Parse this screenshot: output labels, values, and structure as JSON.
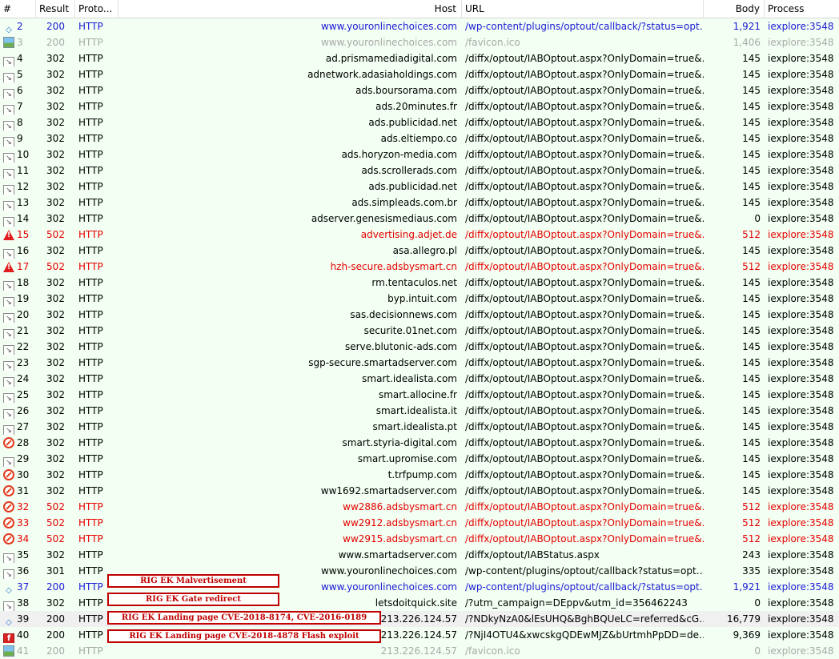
{
  "columns": {
    "num": "#",
    "result": "Result",
    "protocol": "Proto...",
    "host": "Host",
    "url": "URL",
    "body": "Body",
    "process": "Process"
  },
  "colors": {
    "blue": "#1b1bd6",
    "gray": "#a9a9a9",
    "black": "#000000",
    "red": "#e60000",
    "bg_green": "#f2fff2",
    "bg_selected": "#f0f0f0",
    "annotation_red": "#c00000"
  },
  "rows": [
    {
      "num": "2",
      "result": "200",
      "protocol": "HTTP",
      "host": "www.youronlinechoices.com",
      "url": "/wp-content/plugins/optout/callback/?status=opt…",
      "body": "1,921",
      "process": "iexplore:3548",
      "icon": "arrows-icon",
      "color": "blue",
      "bg": "bg_green"
    },
    {
      "num": "3",
      "result": "200",
      "protocol": "HTTP",
      "host": "www.youronlinechoices.com",
      "url": "/favicon.ico",
      "body": "1,406",
      "process": "iexplore:3548",
      "icon": "image-icon",
      "color": "gray",
      "bg": "bg_green"
    },
    {
      "num": "4",
      "result": "302",
      "protocol": "HTTP",
      "host": "ad.prismamediadigital.com",
      "url": "/diffx/optout/IABOptout.aspx?OnlyDomain=true&…",
      "body": "145",
      "process": "iexplore:3548",
      "icon": "redirect-icon",
      "color": "black",
      "bg": "bg_green"
    },
    {
      "num": "5",
      "result": "302",
      "protocol": "HTTP",
      "host": "adnetwork.adasiaholdings.com",
      "url": "/diffx/optout/IABOptout.aspx?OnlyDomain=true&…",
      "body": "145",
      "process": "iexplore:3548",
      "icon": "redirect-icon",
      "color": "black",
      "bg": "bg_green"
    },
    {
      "num": "6",
      "result": "302",
      "protocol": "HTTP",
      "host": "ads.boursorama.com",
      "url": "/diffx/optout/IABOptout.aspx?OnlyDomain=true&…",
      "body": "145",
      "process": "iexplore:3548",
      "icon": "redirect-icon",
      "color": "black",
      "bg": "bg_green"
    },
    {
      "num": "7",
      "result": "302",
      "protocol": "HTTP",
      "host": "ads.20minutes.fr",
      "url": "/diffx/optout/IABOptout.aspx?OnlyDomain=true&…",
      "body": "145",
      "process": "iexplore:3548",
      "icon": "redirect-icon",
      "color": "black",
      "bg": "bg_green"
    },
    {
      "num": "8",
      "result": "302",
      "protocol": "HTTP",
      "host": "ads.publicidad.net",
      "url": "/diffx/optout/IABOptout.aspx?OnlyDomain=true&…",
      "body": "145",
      "process": "iexplore:3548",
      "icon": "redirect-icon",
      "color": "black",
      "bg": "bg_green"
    },
    {
      "num": "9",
      "result": "302",
      "protocol": "HTTP",
      "host": "ads.eltiempo.co",
      "url": "/diffx/optout/IABOptout.aspx?OnlyDomain=true&…",
      "body": "145",
      "process": "iexplore:3548",
      "icon": "redirect-icon",
      "color": "black",
      "bg": "bg_green"
    },
    {
      "num": "10",
      "result": "302",
      "protocol": "HTTP",
      "host": "ads.horyzon-media.com",
      "url": "/diffx/optout/IABOptout.aspx?OnlyDomain=true&…",
      "body": "145",
      "process": "iexplore:3548",
      "icon": "redirect-icon",
      "color": "black",
      "bg": "bg_green"
    },
    {
      "num": "11",
      "result": "302",
      "protocol": "HTTP",
      "host": "ads.scrollerads.com",
      "url": "/diffx/optout/IABOptout.aspx?OnlyDomain=true&…",
      "body": "145",
      "process": "iexplore:3548",
      "icon": "redirect-icon",
      "color": "black",
      "bg": "bg_green"
    },
    {
      "num": "12",
      "result": "302",
      "protocol": "HTTP",
      "host": "ads.publicidad.net",
      "url": "/diffx/optout/IABOptout.aspx?OnlyDomain=true&…",
      "body": "145",
      "process": "iexplore:3548",
      "icon": "redirect-icon",
      "color": "black",
      "bg": "bg_green"
    },
    {
      "num": "13",
      "result": "302",
      "protocol": "HTTP",
      "host": "ads.simpleads.com.br",
      "url": "/diffx/optout/IABOptout.aspx?OnlyDomain=true&…",
      "body": "145",
      "process": "iexplore:3548",
      "icon": "redirect-icon",
      "color": "black",
      "bg": "bg_green"
    },
    {
      "num": "14",
      "result": "302",
      "protocol": "HTTP",
      "host": "adserver.genesismediaus.com",
      "url": "/diffx/optout/IABOptout.aspx?OnlyDomain=true&…",
      "body": "0",
      "process": "iexplore:3548",
      "icon": "redirect-icon",
      "color": "black",
      "bg": "bg_green"
    },
    {
      "num": "15",
      "result": "502",
      "protocol": "HTTP",
      "host": "advertising.adjet.de",
      "url": "/diffx/optout/IABOptout.aspx?OnlyDomain=true&…",
      "body": "512",
      "process": "iexplore:3548",
      "icon": "warning-icon",
      "color": "red",
      "bg": "bg_green"
    },
    {
      "num": "16",
      "result": "302",
      "protocol": "HTTP",
      "host": "asa.allegro.pl",
      "url": "/diffx/optout/IABOptout.aspx?OnlyDomain=true&…",
      "body": "145",
      "process": "iexplore:3548",
      "icon": "redirect-icon",
      "color": "black",
      "bg": "bg_green"
    },
    {
      "num": "17",
      "result": "502",
      "protocol": "HTTP",
      "host": "hzh-secure.adsbysmart.cn",
      "url": "/diffx/optout/IABOptout.aspx?OnlyDomain=true&…",
      "body": "512",
      "process": "iexplore:3548",
      "icon": "warning-icon",
      "color": "red",
      "bg": "bg_green"
    },
    {
      "num": "18",
      "result": "302",
      "protocol": "HTTP",
      "host": "rm.tentaculos.net",
      "url": "/diffx/optout/IABOptout.aspx?OnlyDomain=true&…",
      "body": "145",
      "process": "iexplore:3548",
      "icon": "redirect-icon",
      "color": "black",
      "bg": "bg_green"
    },
    {
      "num": "19",
      "result": "302",
      "protocol": "HTTP",
      "host": "byp.intuit.com",
      "url": "/diffx/optout/IABOptout.aspx?OnlyDomain=true&…",
      "body": "145",
      "process": "iexplore:3548",
      "icon": "redirect-icon",
      "color": "black",
      "bg": "bg_green"
    },
    {
      "num": "20",
      "result": "302",
      "protocol": "HTTP",
      "host": "sas.decisionnews.com",
      "url": "/diffx/optout/IABOptout.aspx?OnlyDomain=true&…",
      "body": "145",
      "process": "iexplore:3548",
      "icon": "redirect-icon",
      "color": "black",
      "bg": "bg_green"
    },
    {
      "num": "21",
      "result": "302",
      "protocol": "HTTP",
      "host": "securite.01net.com",
      "url": "/diffx/optout/IABOptout.aspx?OnlyDomain=true&…",
      "body": "145",
      "process": "iexplore:3548",
      "icon": "redirect-icon",
      "color": "black",
      "bg": "bg_green"
    },
    {
      "num": "22",
      "result": "302",
      "protocol": "HTTP",
      "host": "serve.blutonic-ads.com",
      "url": "/diffx/optout/IABOptout.aspx?OnlyDomain=true&…",
      "body": "145",
      "process": "iexplore:3548",
      "icon": "redirect-icon",
      "color": "black",
      "bg": "bg_green"
    },
    {
      "num": "23",
      "result": "302",
      "protocol": "HTTP",
      "host": "sgp-secure.smartadserver.com",
      "url": "/diffx/optout/IABOptout.aspx?OnlyDomain=true&…",
      "body": "145",
      "process": "iexplore:3548",
      "icon": "redirect-icon",
      "color": "black",
      "bg": "bg_green"
    },
    {
      "num": "24",
      "result": "302",
      "protocol": "HTTP",
      "host": "smart.idealista.com",
      "url": "/diffx/optout/IABOptout.aspx?OnlyDomain=true&…",
      "body": "145",
      "process": "iexplore:3548",
      "icon": "redirect-icon",
      "color": "black",
      "bg": "bg_green"
    },
    {
      "num": "25",
      "result": "302",
      "protocol": "HTTP",
      "host": "smart.allocine.fr",
      "url": "/diffx/optout/IABOptout.aspx?OnlyDomain=true&…",
      "body": "145",
      "process": "iexplore:3548",
      "icon": "redirect-icon",
      "color": "black",
      "bg": "bg_green"
    },
    {
      "num": "26",
      "result": "302",
      "protocol": "HTTP",
      "host": "smart.idealista.it",
      "url": "/diffx/optout/IABOptout.aspx?OnlyDomain=true&…",
      "body": "145",
      "process": "iexplore:3548",
      "icon": "redirect-icon",
      "color": "black",
      "bg": "bg_green"
    },
    {
      "num": "27",
      "result": "302",
      "protocol": "HTTP",
      "host": "smart.idealista.pt",
      "url": "/diffx/optout/IABOptout.aspx?OnlyDomain=true&…",
      "body": "145",
      "process": "iexplore:3548",
      "icon": "redirect-icon",
      "color": "black",
      "bg": "bg_green"
    },
    {
      "num": "28",
      "result": "302",
      "protocol": "HTTP",
      "host": "smart.styria-digital.com",
      "url": "/diffx/optout/IABOptout.aspx?OnlyDomain=true&…",
      "body": "145",
      "process": "iexplore:3548",
      "icon": "blocked-icon",
      "color": "black",
      "bg": "bg_green"
    },
    {
      "num": "29",
      "result": "302",
      "protocol": "HTTP",
      "host": "smart.upromise.com",
      "url": "/diffx/optout/IABOptout.aspx?OnlyDomain=true&…",
      "body": "145",
      "process": "iexplore:3548",
      "icon": "redirect-icon",
      "color": "black",
      "bg": "bg_green"
    },
    {
      "num": "30",
      "result": "302",
      "protocol": "HTTP",
      "host": "t.trfpump.com",
      "url": "/diffx/optout/IABOptout.aspx?OnlyDomain=true&…",
      "body": "145",
      "process": "iexplore:3548",
      "icon": "blocked-icon",
      "color": "black",
      "bg": "bg_green"
    },
    {
      "num": "31",
      "result": "302",
      "protocol": "HTTP",
      "host": "ww1692.smartadserver.com",
      "url": "/diffx/optout/IABOptout.aspx?OnlyDomain=true&…",
      "body": "145",
      "process": "iexplore:3548",
      "icon": "blocked-icon",
      "color": "black",
      "bg": "bg_green"
    },
    {
      "num": "32",
      "result": "502",
      "protocol": "HTTP",
      "host": "ww2886.adsbysmart.cn",
      "url": "/diffx/optout/IABOptout.aspx?OnlyDomain=true&…",
      "body": "512",
      "process": "iexplore:3548",
      "icon": "blocked-icon",
      "color": "red",
      "bg": "bg_green"
    },
    {
      "num": "33",
      "result": "502",
      "protocol": "HTTP",
      "host": "ww2912.adsbysmart.cn",
      "url": "/diffx/optout/IABOptout.aspx?OnlyDomain=true&…",
      "body": "512",
      "process": "iexplore:3548",
      "icon": "blocked-icon",
      "color": "red",
      "bg": "bg_green"
    },
    {
      "num": "34",
      "result": "502",
      "protocol": "HTTP",
      "host": "ww2915.adsbysmart.cn",
      "url": "/diffx/optout/IABOptout.aspx?OnlyDomain=true&…",
      "body": "512",
      "process": "iexplore:3548",
      "icon": "blocked-icon",
      "color": "red",
      "bg": "bg_green"
    },
    {
      "num": "35",
      "result": "302",
      "protocol": "HTTP",
      "host": "www.smartadserver.com",
      "url": "/diffx/optout/IABStatus.aspx",
      "body": "243",
      "process": "iexplore:3548",
      "icon": "redirect-icon",
      "color": "black",
      "bg": "bg_green"
    },
    {
      "num": "36",
      "result": "301",
      "protocol": "HTTP",
      "host": "www.youronlinechoices.com",
      "url": "/wp-content/plugins/optout/callback?status=opt…",
      "body": "335",
      "process": "iexplore:3548",
      "icon": "redirect-icon",
      "color": "black",
      "bg": "bg_green"
    },
    {
      "num": "37",
      "result": "200",
      "protocol": "HTTP",
      "host": "www.youronlinechoices.com",
      "url": "/wp-content/plugins/optout/callback/?status=opt…",
      "body": "1,921",
      "process": "iexplore:3548",
      "icon": "arrows-icon",
      "color": "blue",
      "bg": "bg_green"
    },
    {
      "num": "38",
      "result": "302",
      "protocol": "HTTP",
      "host": "letsdoitquick.site",
      "url": "/?utm_campaign=DEppv&utm_id=356462243",
      "body": "0",
      "process": "iexplore:3548",
      "icon": "redirect-icon",
      "color": "black",
      "bg": "bg_green"
    },
    {
      "num": "39",
      "result": "200",
      "protocol": "HTTP",
      "host": "213.226.124.57",
      "url": "/?NDkyNzA0&lEsUHQ&BghBQUeLC=referred&cG…",
      "body": "16,779",
      "process": "iexplore:3548",
      "icon": "arrows-icon",
      "color": "black",
      "bg": "bg_selected"
    },
    {
      "num": "40",
      "result": "200",
      "protocol": "HTTP",
      "host": "213.226.124.57",
      "url": "/?NjI4OTU4&xwcskgQDEwMJZ&bUrtmhPpDD=de…",
      "body": "9,369",
      "process": "iexplore:3548",
      "icon": "flash-icon",
      "color": "black",
      "bg": "bg_green"
    },
    {
      "num": "41",
      "result": "200",
      "protocol": "HTTP",
      "host": "213.226.124.57",
      "url": "/favicon.ico",
      "body": "0",
      "process": "iexplore:3548",
      "icon": "image-icon",
      "color": "gray",
      "bg": "bg_green"
    }
  ],
  "annotations": [
    {
      "label": "RIG EK Malvertisement"
    },
    {
      "label": "RIG EK Gate redirect"
    },
    {
      "label": "RIG EK Landing page CVE-2018-8174, CVE-2016-0189"
    },
    {
      "label": "RIG EK Landing page CVE-2018-4878 Flash exploit"
    }
  ]
}
